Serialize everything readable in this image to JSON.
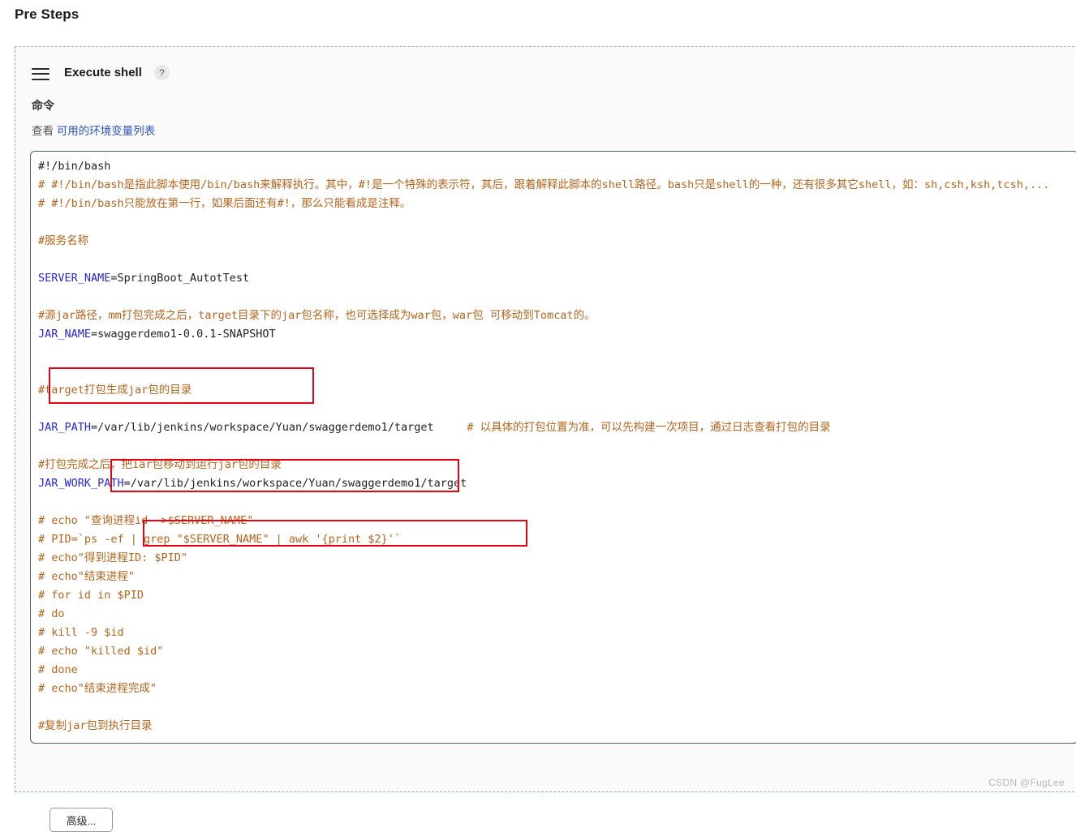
{
  "page": {
    "title": "Pre Steps",
    "watermark": "CSDN @FugLee"
  },
  "step": {
    "drag_handle_icon": "hamburger-drag-icon",
    "title": "Execute shell",
    "help_icon": "?",
    "field_label": "命令",
    "help_prefix": "查看",
    "help_link": "可用的环境变量列表",
    "advanced_button": "高级..."
  },
  "colors": {
    "comment": "#b5651d",
    "variable": "#2727d6",
    "text": "#222222",
    "link": "#2a55b5",
    "highlight_box": "#e60012",
    "textarea_border": "#4b6170",
    "container_border": "#9aa4ae"
  },
  "script": {
    "lines": [
      {
        "segments": [
          {
            "t": "#!/bin/bash",
            "c": "txt"
          }
        ]
      },
      {
        "segments": [
          {
            "t": "# #!/bin/bash是指此脚本使用/bin/bash来解释执行。其中，#!是一个特殊的表示符，其后，跟着解释此脚本的shell路径。bash只是shell的一种，还有很多其它shell，如：sh,csh,ksh,tcsh,...",
            "c": "cmt"
          }
        ]
      },
      {
        "segments": [
          {
            "t": "# #!/bin/bash只能放在第一行，如果后面还有#!，那么只能看成是注释。",
            "c": "cmt"
          }
        ]
      },
      {
        "segments": [
          {
            "t": "",
            "c": "txt"
          }
        ]
      },
      {
        "segments": [
          {
            "t": "#服务名称",
            "c": "cmt"
          }
        ]
      },
      {
        "segments": [
          {
            "t": "",
            "c": "txt"
          }
        ]
      },
      {
        "segments": [
          {
            "t": "SERVER_NAME",
            "c": "var"
          },
          {
            "t": "=SpringBoot_AutotTest",
            "c": "txt"
          }
        ]
      },
      {
        "segments": [
          {
            "t": "",
            "c": "txt"
          }
        ]
      },
      {
        "segments": [
          {
            "t": "#源jar路径，mm打包完成之后，target目录下的jar包名称，也可选择成为war包，war包 可移动到Tomcat的。",
            "c": "cmt"
          }
        ]
      },
      {
        "segments": [
          {
            "t": "JAR_NAME",
            "c": "var"
          },
          {
            "t": "=swaggerdemo1-0.0.1-SNAPSHOT",
            "c": "txt"
          }
        ]
      },
      {
        "segments": [
          {
            "t": "",
            "c": "txt"
          }
        ]
      },
      {
        "segments": [
          {
            "t": "",
            "c": "txt"
          }
        ]
      },
      {
        "segments": [
          {
            "t": "#target打包生成jar包的目录",
            "c": "cmt"
          }
        ]
      },
      {
        "segments": [
          {
            "t": "",
            "c": "txt"
          }
        ]
      },
      {
        "segments": [
          {
            "t": "JAR_PATH",
            "c": "var"
          },
          {
            "t": "=/var/lib/jenkins/workspace/Yuan/swaggerdemo1/target     ",
            "c": "txt"
          },
          {
            "t": "# 以具体的打包位置为准，可以先构建一次项目，通过日志查看打包的目录",
            "c": "cmt"
          }
        ]
      },
      {
        "segments": [
          {
            "t": "",
            "c": "txt"
          }
        ]
      },
      {
        "segments": [
          {
            "t": "#打包完成之后，把iar包移动到运行jar包的目录",
            "c": "cmt"
          }
        ]
      },
      {
        "segments": [
          {
            "t": "JAR_WORK_PATH",
            "c": "var"
          },
          {
            "t": "=/var/lib/jenkins/workspace/Yuan/swaggerdemo1/target",
            "c": "txt"
          }
        ]
      },
      {
        "segments": [
          {
            "t": "",
            "c": "txt"
          }
        ]
      },
      {
        "segments": [
          {
            "t": "# echo \"查询进程id-->$SERVER_NAME\"",
            "c": "cmt"
          }
        ]
      },
      {
        "segments": [
          {
            "t": "# PID=`ps -ef | grep \"$SERVER_NAME\" | awk '{print $2}'`",
            "c": "cmt"
          }
        ]
      },
      {
        "segments": [
          {
            "t": "# echo\"得到进程ID: $PID\"",
            "c": "cmt"
          }
        ]
      },
      {
        "segments": [
          {
            "t": "# echo\"结束进程\"",
            "c": "cmt"
          }
        ]
      },
      {
        "segments": [
          {
            "t": "# for id in $PID",
            "c": "cmt"
          }
        ]
      },
      {
        "segments": [
          {
            "t": "# do",
            "c": "cmt"
          }
        ]
      },
      {
        "segments": [
          {
            "t": "# kill -9 $id",
            "c": "cmt"
          }
        ]
      },
      {
        "segments": [
          {
            "t": "# echo \"killed $id\"",
            "c": "cmt"
          }
        ]
      },
      {
        "segments": [
          {
            "t": "# done",
            "c": "cmt"
          }
        ]
      },
      {
        "segments": [
          {
            "t": "# echo\"结束进程完成\"",
            "c": "cmt"
          }
        ]
      },
      {
        "segments": [
          {
            "t": "",
            "c": "txt"
          }
        ]
      },
      {
        "segments": [
          {
            "t": "#复制jar包到执行目录",
            "c": "cmt"
          }
        ]
      }
    ]
  }
}
